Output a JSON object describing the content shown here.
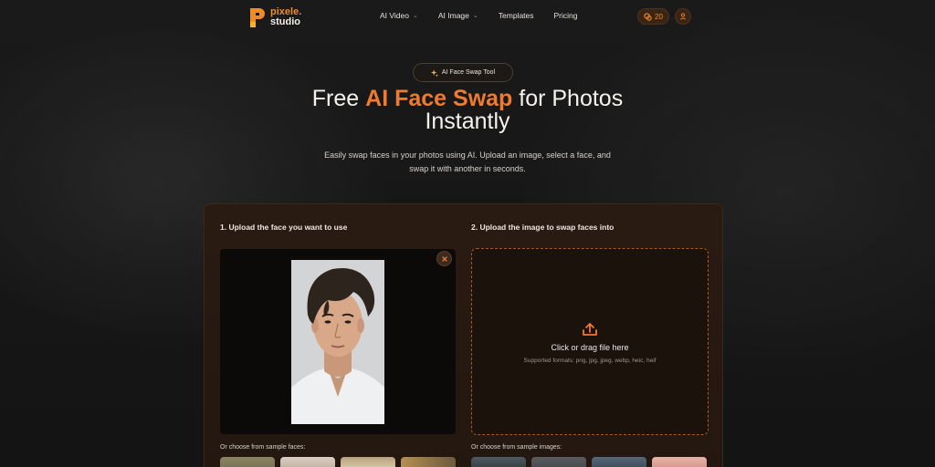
{
  "header": {
    "logo": {
      "line1": "pixele",
      "line1_dot": ".",
      "line2": "studio"
    },
    "nav": [
      {
        "label": "AI Video",
        "has_dropdown": true
      },
      {
        "label": "AI Image",
        "has_dropdown": true
      },
      {
        "label": "Templates",
        "has_dropdown": false
      },
      {
        "label": "Pricing",
        "has_dropdown": false
      }
    ],
    "credits": "20"
  },
  "hero": {
    "badge": "AI Face Swap Tool",
    "title_pre": "Free ",
    "title_highlight": "AI Face Swap",
    "title_post": " for Photos",
    "title_line2": "Instantly",
    "subtitle_line1": "Easily swap faces in your photos using AI. Upload an image, select a face, and",
    "subtitle_line2": "swap it with another in seconds."
  },
  "tool": {
    "step1_label": "1. Upload the face you want to use",
    "step2_label": "2. Upload the image to swap faces into",
    "drop_title": "Click or drag file here",
    "drop_formats": "Supported formats: png, jpg, jpeg, webp, heic, heif",
    "sample_faces_label": "Or choose from sample faces:",
    "sample_images_label": "Or choose from sample images:"
  },
  "colors": {
    "accent": "#f07a2e",
    "background": "#161616",
    "panel": "#261911"
  }
}
